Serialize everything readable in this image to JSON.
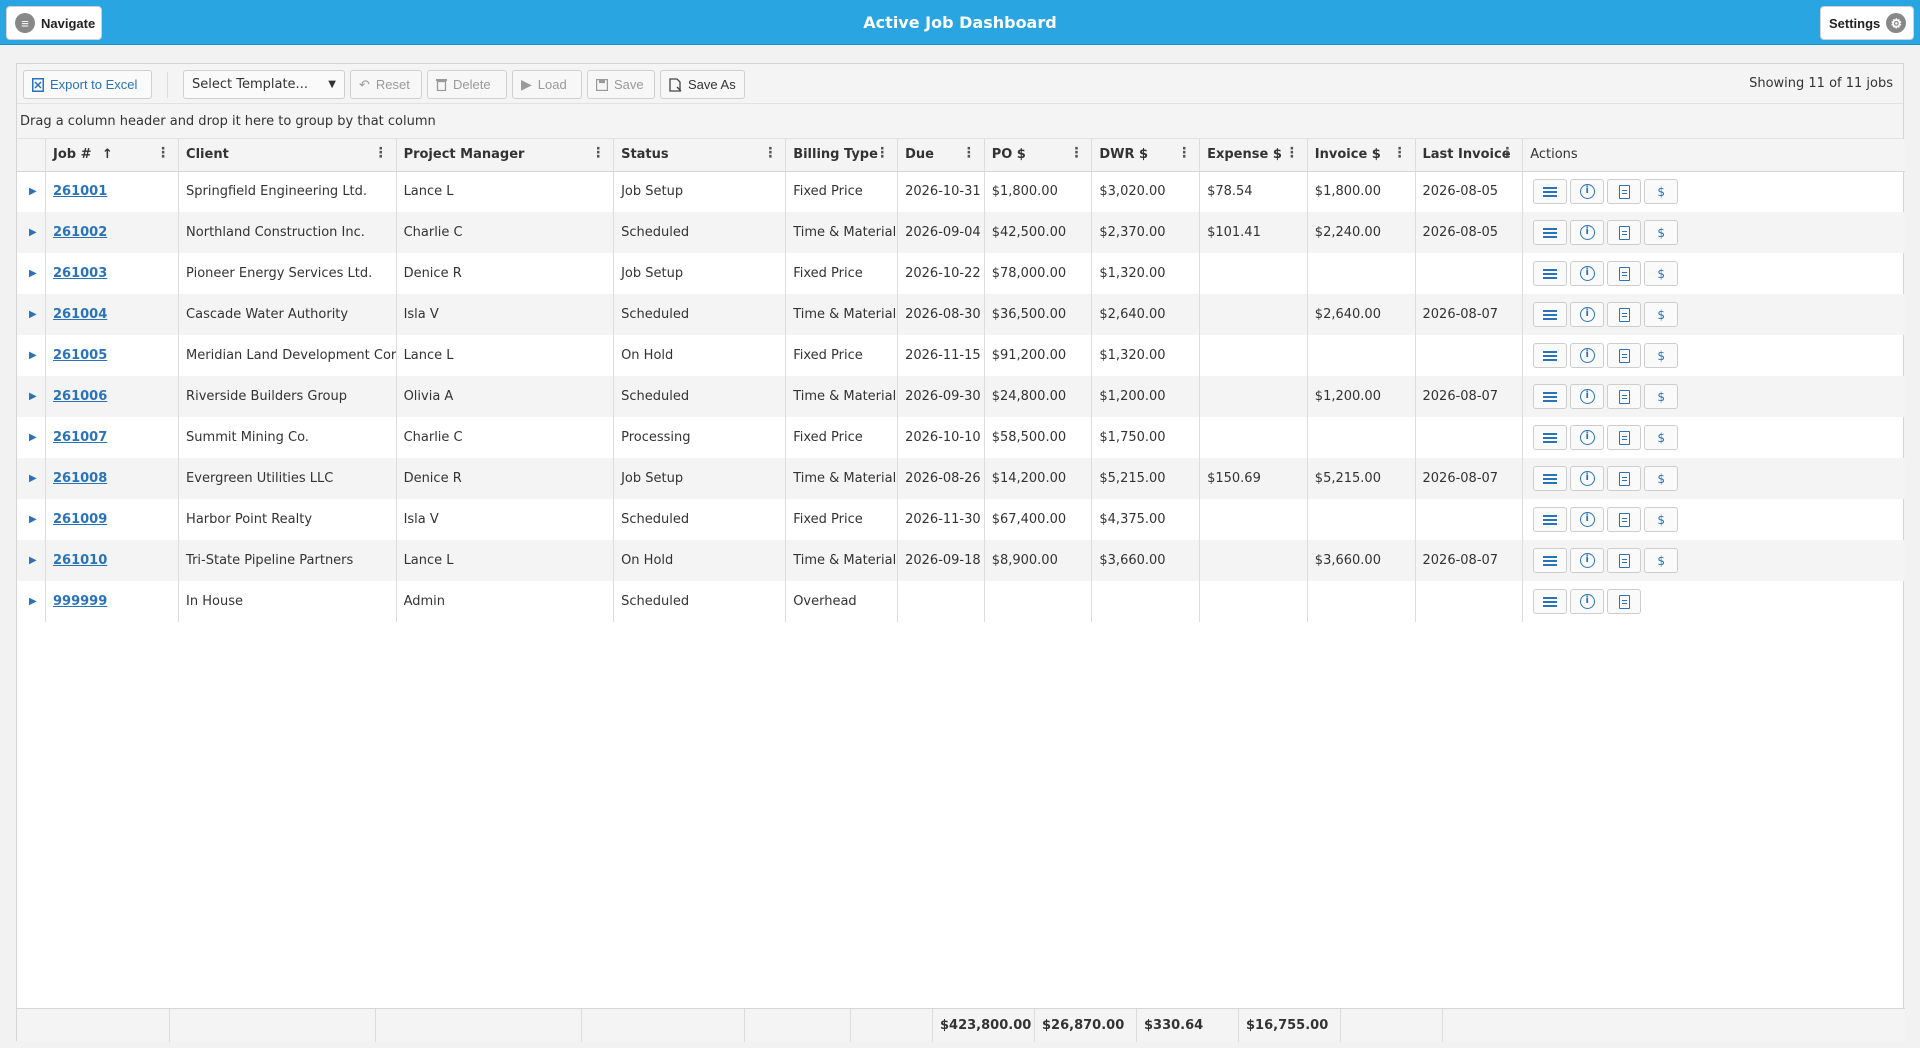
{
  "header": {
    "title": "Active Job Dashboard",
    "navigate_label": "Navigate",
    "settings_label": "Settings"
  },
  "toolbar": {
    "export_label": "Export to Excel",
    "template_selected": "Select Template...",
    "reset_label": "Reset",
    "delete_label": "Delete",
    "load_label": "Load",
    "save_label": "Save",
    "save_as_label": "Save As",
    "showing_text": "Showing 11 of 11 jobs"
  },
  "group_hint": "Drag a column header and drop it here to group by that column",
  "columns": {
    "job": "Job #",
    "client": "Client",
    "pm": "Project Manager",
    "status": "Status",
    "billing": "Billing Type",
    "due": "Due",
    "po": "PO $",
    "dwr": "DWR $",
    "expense": "Expense $",
    "invoice": "Invoice $",
    "last_invoice": "Last Invoice",
    "actions": "Actions"
  },
  "rows": [
    {
      "job": "261001",
      "client": "Springfield Engineering Ltd.",
      "pm": "Lance L",
      "status": "Job Setup",
      "billing": "Fixed Price",
      "due": "2026-10-31",
      "po": "$1,800.00",
      "dwr": "$3,020.00",
      "expense": "$78.54",
      "invoice": "$1,800.00",
      "last_invoice": "2026-08-05"
    },
    {
      "job": "261002",
      "client": "Northland Construction Inc.",
      "pm": "Charlie C",
      "status": "Scheduled",
      "billing": "Time & Materials",
      "due": "2026-09-04",
      "po": "$42,500.00",
      "dwr": "$2,370.00",
      "expense": "$101.41",
      "invoice": "$2,240.00",
      "last_invoice": "2026-08-05"
    },
    {
      "job": "261003",
      "client": "Pioneer Energy Services Ltd.",
      "pm": "Denice R",
      "status": "Job Setup",
      "billing": "Fixed Price",
      "due": "2026-10-22",
      "po": "$78,000.00",
      "dwr": "$1,320.00",
      "expense": "",
      "invoice": "",
      "last_invoice": ""
    },
    {
      "job": "261004",
      "client": "Cascade Water Authority",
      "pm": "Isla V",
      "status": "Scheduled",
      "billing": "Time & Materials",
      "due": "2026-08-30",
      "po": "$36,500.00",
      "dwr": "$2,640.00",
      "expense": "",
      "invoice": "$2,640.00",
      "last_invoice": "2026-08-07"
    },
    {
      "job": "261005",
      "client": "Meridian Land Development Corp.",
      "pm": "Lance L",
      "status": "On Hold",
      "billing": "Fixed Price",
      "due": "2026-11-15",
      "po": "$91,200.00",
      "dwr": "$1,320.00",
      "expense": "",
      "invoice": "",
      "last_invoice": ""
    },
    {
      "job": "261006",
      "client": "Riverside Builders Group",
      "pm": "Olivia A",
      "status": "Scheduled",
      "billing": "Time & Materials",
      "due": "2026-09-30",
      "po": "$24,800.00",
      "dwr": "$1,200.00",
      "expense": "",
      "invoice": "$1,200.00",
      "last_invoice": "2026-08-07"
    },
    {
      "job": "261007",
      "client": "Summit Mining Co.",
      "pm": "Charlie C",
      "status": "Processing",
      "billing": "Fixed Price",
      "due": "2026-10-10",
      "po": "$58,500.00",
      "dwr": "$1,750.00",
      "expense": "",
      "invoice": "",
      "last_invoice": ""
    },
    {
      "job": "261008",
      "client": "Evergreen Utilities LLC",
      "pm": "Denice R",
      "status": "Job Setup",
      "billing": "Time & Materials",
      "due": "2026-08-26",
      "po": "$14,200.00",
      "dwr": "$5,215.00",
      "expense": "$150.69",
      "invoice": "$5,215.00",
      "last_invoice": "2026-08-07"
    },
    {
      "job": "261009",
      "client": "Harbor Point Realty",
      "pm": "Isla V",
      "status": "Scheduled",
      "billing": "Fixed Price",
      "due": "2026-11-30",
      "po": "$67,400.00",
      "dwr": "$4,375.00",
      "expense": "",
      "invoice": "",
      "last_invoice": ""
    },
    {
      "job": "261010",
      "client": "Tri-State Pipeline Partners",
      "pm": "Lance L",
      "status": "On Hold",
      "billing": "Time & Materials",
      "due": "2026-09-18",
      "po": "$8,900.00",
      "dwr": "$3,660.00",
      "expense": "",
      "invoice": "$3,660.00",
      "last_invoice": "2026-08-07"
    },
    {
      "job": "999999",
      "client": "In House",
      "pm": "Admin",
      "status": "Scheduled",
      "billing": "Overhead",
      "due": "",
      "po": "",
      "dwr": "",
      "expense": "",
      "invoice": "",
      "last_invoice": "",
      "no_invoice_action": true
    }
  ],
  "totals": {
    "po": "$423,800.00",
    "dwr": "$26,870.00",
    "expense": "$330.64",
    "invoice": "$16,755.00"
  },
  "icons": {
    "navigate": "hamburger-circle-icon",
    "settings": "gear-icon",
    "export": "excel-file-icon",
    "reset": "undo-arrow-icon",
    "delete": "trash-icon",
    "load": "play-icon",
    "save": "floppy-disk-icon",
    "save_as": "save-as-file-icon",
    "sort": "sort-ascending-icon",
    "column_menu": "kebab-menu-icon",
    "row_expand": "caret-right-icon",
    "action_detail": "list-icon",
    "action_info": "info-icon",
    "action_report": "document-icon",
    "action_invoice": "dollar-icon"
  },
  "colors": {
    "header_bar": "#29a5e2",
    "link": "#2a73b8",
    "row_alt": "#f4f4f4"
  }
}
